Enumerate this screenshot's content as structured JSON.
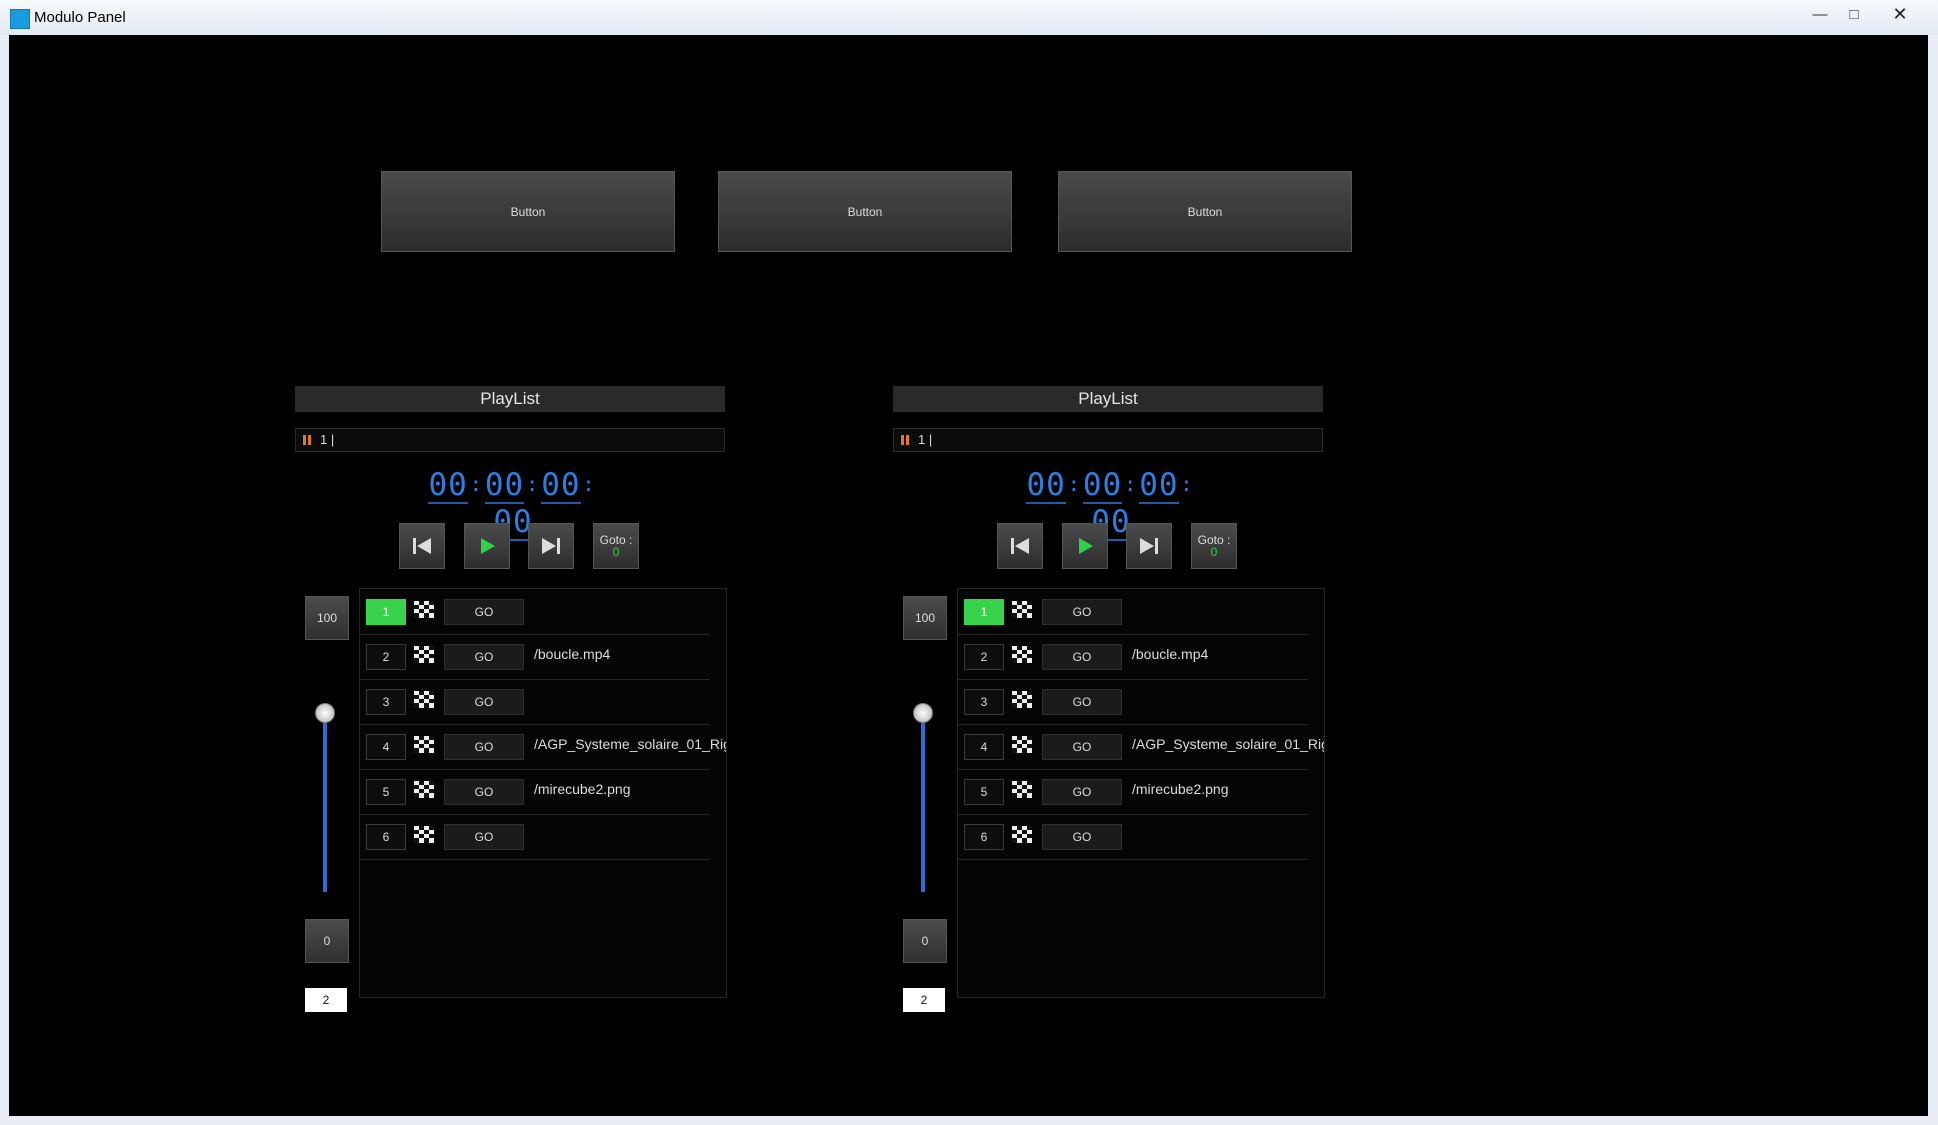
{
  "window": {
    "title": "Modulo Panel",
    "min_label": "—",
    "max_label": "□",
    "close_label": "✕"
  },
  "top_buttons": [
    {
      "label": "Button"
    },
    {
      "label": "Button"
    },
    {
      "label": "Button"
    }
  ],
  "playlists": [
    {
      "title": "PlayList",
      "status": "1 |",
      "timecode": [
        "00",
        "00",
        "00",
        "00"
      ],
      "goto_label": "Goto :",
      "goto_value": "0",
      "volume_max": "100",
      "volume_min": "0",
      "volume_level": 1.0,
      "page": "2",
      "rows": [
        {
          "num": "1",
          "go": "GO",
          "file": "",
          "active": true
        },
        {
          "num": "2",
          "go": "GO",
          "file": "/boucle.mp4"
        },
        {
          "num": "3",
          "go": "GO",
          "file": ""
        },
        {
          "num": "4",
          "go": "GO",
          "file": "/AGP_Systeme_solaire_01_Rig"
        },
        {
          "num": "5",
          "go": "GO",
          "file": "/mirecube2.png"
        },
        {
          "num": "6",
          "go": "GO",
          "file": ""
        }
      ]
    },
    {
      "title": "PlayList",
      "status": "1 |",
      "timecode": [
        "00",
        "00",
        "00",
        "00"
      ],
      "goto_label": "Goto :",
      "goto_value": "0",
      "volume_max": "100",
      "volume_min": "0",
      "volume_level": 1.0,
      "page": "2",
      "rows": [
        {
          "num": "1",
          "go": "GO",
          "file": "",
          "active": true
        },
        {
          "num": "2",
          "go": "GO",
          "file": "/boucle.mp4"
        },
        {
          "num": "3",
          "go": "GO",
          "file": ""
        },
        {
          "num": "4",
          "go": "GO",
          "file": "/AGP_Systeme_solaire_01_Rig"
        },
        {
          "num": "5",
          "go": "GO",
          "file": "/mirecube2.png"
        },
        {
          "num": "6",
          "go": "GO",
          "file": ""
        }
      ]
    }
  ],
  "colors": {
    "accent": "#2b7fe0",
    "active": "#37d34a",
    "pause": "#e57a1a"
  }
}
